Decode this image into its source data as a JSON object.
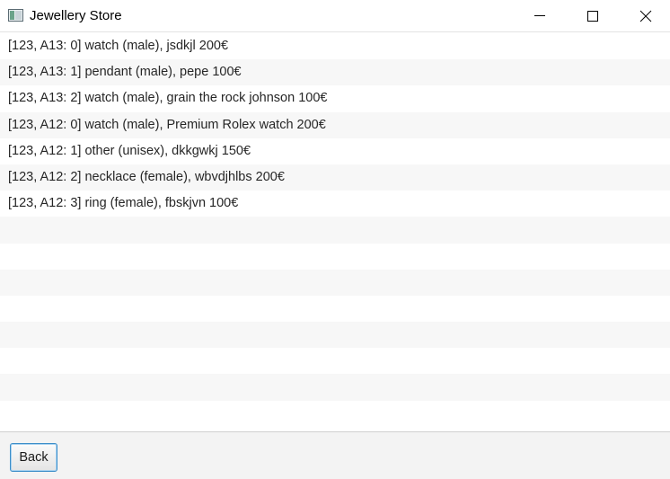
{
  "window": {
    "title": "Jewellery Store",
    "app_icon": "app-window-icon",
    "controls": [
      "minimize-icon",
      "maximize-icon",
      "close-icon"
    ]
  },
  "list": {
    "items": [
      "[123, A13: 0] watch (male), jsdkjl 200€",
      "[123, A13: 1] pendant (male), pepe 100€",
      "[123, A13: 2] watch (male), grain the rock johnson 100€",
      "[123, A12: 0] watch (male), Premium Rolex watch 200€",
      "[123, A12: 1] other (unisex), dkkgwkj 150€",
      "[123, A12: 2] necklace (female), wbvdjhlbs 200€",
      "[123, A12: 3] ring (female), fbskjvn 100€"
    ],
    "empty_rows": 8,
    "stripe_color": "#f7f7f7"
  },
  "footer": {
    "back_label": "Back",
    "back_border_color": "#3c8ec9"
  }
}
